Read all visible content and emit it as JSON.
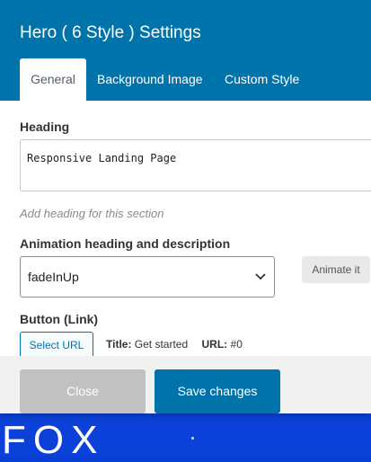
{
  "background": {
    "brand_text": "FOX"
  },
  "modal": {
    "title": "Hero ( 6 Style ) Settings",
    "tabs": [
      {
        "label": "General",
        "active": true
      },
      {
        "label": "Background Image",
        "active": false
      },
      {
        "label": "Custom Style",
        "active": false
      }
    ]
  },
  "form": {
    "heading": {
      "label": "Heading",
      "value": "Responsive Landing Page",
      "help": "Add heading for this section"
    },
    "animation": {
      "label": "Animation heading and description",
      "selected": "fadeInUp",
      "animate_label": "Animate it"
    },
    "button_link": {
      "label": "Button (Link)",
      "select_url_label": "Select URL",
      "title_key": "Title:",
      "title_value": "Get started",
      "url_key": "URL:",
      "url_value": "#0"
    }
  },
  "footer": {
    "close_label": "Close",
    "save_label": "Save changes"
  },
  "colors": {
    "header": "#0073aa",
    "primary_button": "#0073aa",
    "disabled_button": "#c1c1c1",
    "page_background": "#0a3fd6"
  }
}
